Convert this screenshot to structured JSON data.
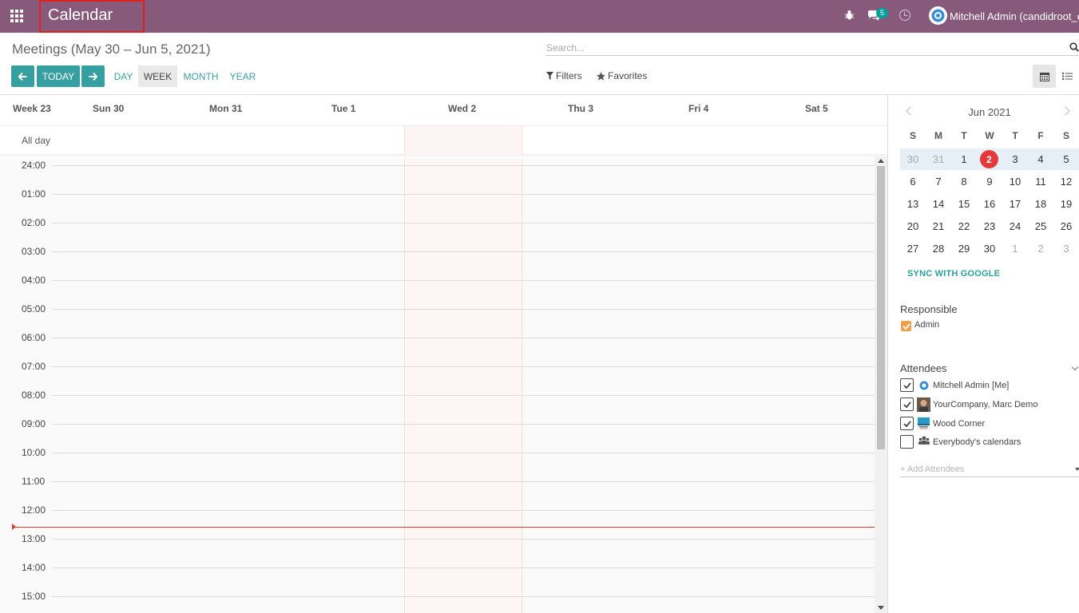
{
  "nav": {
    "app_title": "Calendar",
    "messages_count": "5",
    "user_name": "Mitchell Admin (candidroot_ee)"
  },
  "control_panel": {
    "breadcrumb": "Meetings (May 30 – Jun 5, 2021)",
    "search_placeholder": "Search...",
    "today_label": "TODAY",
    "scales": [
      "DAY",
      "WEEK",
      "MONTH",
      "YEAR"
    ],
    "active_scale": "WEEK",
    "filters_label": "Filters",
    "favorites_label": "Favorites"
  },
  "calendar": {
    "week_label": "Week 23",
    "days": [
      "Sun 30",
      "Mon 31",
      "Tue 1",
      "Wed 2",
      "Thu 3",
      "Fri 4",
      "Sat 5"
    ],
    "allday_label": "All day",
    "hours": [
      "24:00",
      "01:00",
      "02:00",
      "03:00",
      "04:00",
      "05:00",
      "06:00",
      "07:00",
      "08:00",
      "09:00",
      "10:00",
      "11:00",
      "12:00",
      "13:00",
      "14:00",
      "15:00"
    ]
  },
  "sidebar": {
    "month_title": "Jun 2021",
    "dow": [
      "S",
      "M",
      "T",
      "W",
      "T",
      "F",
      "S"
    ],
    "weeks": [
      [
        "30",
        "31",
        "1",
        "2",
        "3",
        "4",
        "5"
      ],
      [
        "6",
        "7",
        "8",
        "9",
        "10",
        "11",
        "12"
      ],
      [
        "13",
        "14",
        "15",
        "16",
        "17",
        "18",
        "19"
      ],
      [
        "20",
        "21",
        "22",
        "23",
        "24",
        "25",
        "26"
      ],
      [
        "27",
        "28",
        "29",
        "30",
        "1",
        "2",
        "3"
      ]
    ],
    "sync_label": "SYNC WITH GOOGLE",
    "responsible_title": "Responsible",
    "responsible_name": "Admin",
    "attendees_title": "Attendees",
    "attendees": [
      {
        "name": "Mitchell Admin [Me]",
        "checked": true
      },
      {
        "name": "YourCompany, Marc Demo",
        "checked": true
      },
      {
        "name": "Wood Corner",
        "checked": true
      },
      {
        "name": "Everybody's calendars",
        "checked": false
      }
    ],
    "add_attendees_placeholder": "+ Add Attendees"
  },
  "colors": {
    "brand": "#875a7b",
    "accent": "#36a0a0",
    "today": "#e4393a"
  }
}
